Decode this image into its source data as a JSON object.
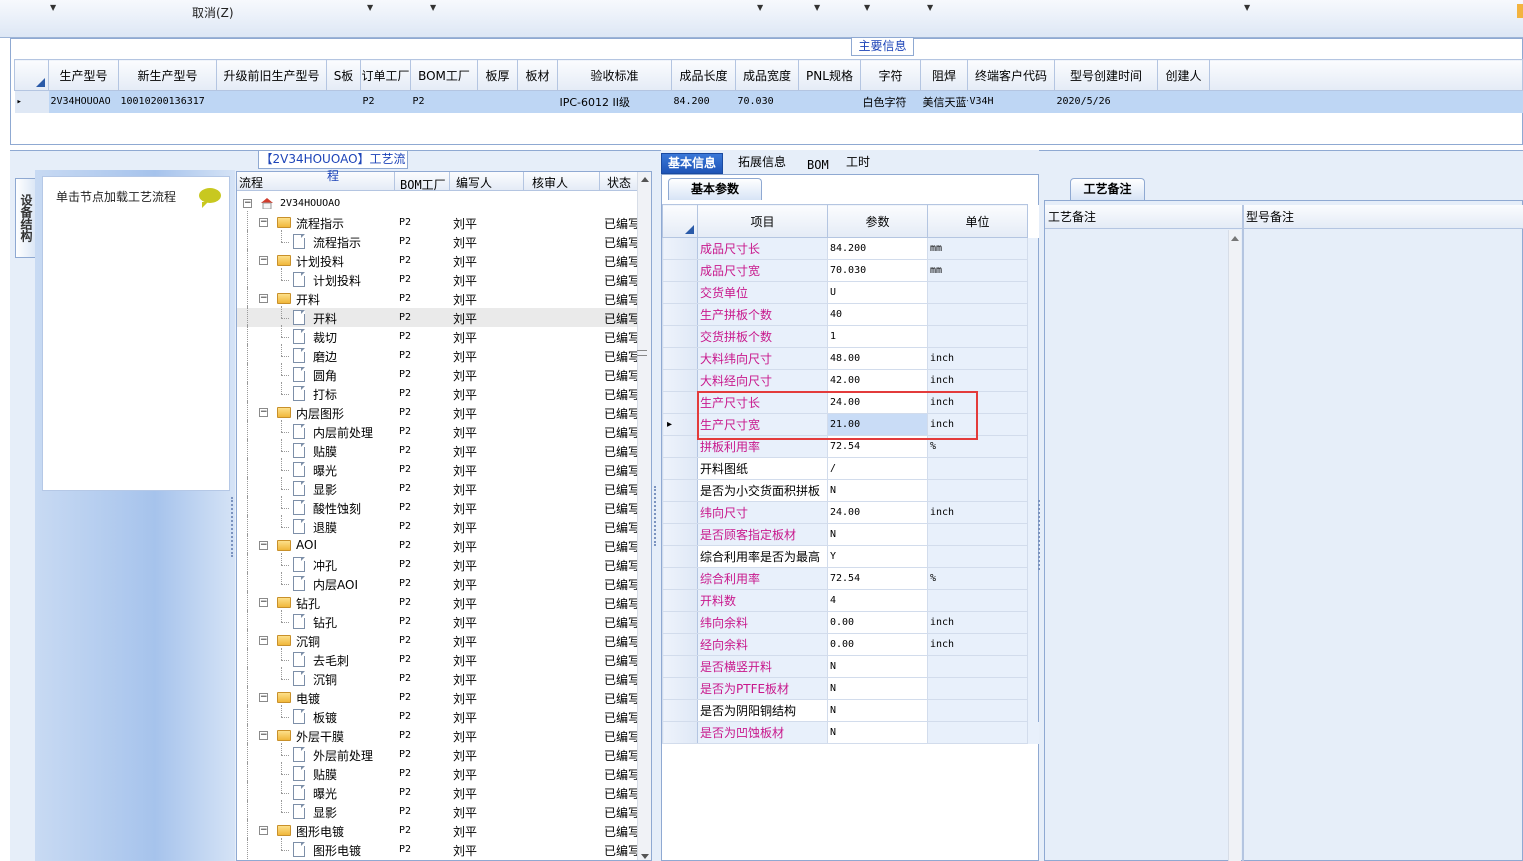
{
  "toolbar": {
    "cancel_label": "取消(Z)"
  },
  "main_info": {
    "title": "主要信息",
    "columns": [
      "生产型号",
      "新生产型号",
      "升级前旧生产型号",
      "S板",
      "订单工厂",
      "BOM工厂",
      "板厚",
      "板材",
      "验收标准",
      "成品长度",
      "成品宽度",
      "PNL规格",
      "字符",
      "阻焊",
      "终端客户代码",
      "型号创建时间",
      "创建人"
    ],
    "row": [
      "2V34HOUOAO",
      "10010200136317",
      "",
      "",
      "P2",
      "P2",
      "",
      "",
      "IPC-6012 II级",
      "84.200",
      "70.030",
      "",
      "白色字符",
      "美信天蓝色",
      "V34H",
      "2020/5/26",
      ""
    ]
  },
  "left_nav": {
    "vertical_tab": "设备结构",
    "hint": "单击节点加载工艺流程"
  },
  "process": {
    "title": "【2V34HOUOAO】工艺流程",
    "columns": [
      "流程",
      "BOM工厂",
      "编写人",
      "核审人",
      "状态"
    ],
    "rows": [
      {
        "name": "2V34HOUOAO",
        "lvl": 0,
        "type": "root",
        "bom": "",
        "writer": "",
        "status": ""
      },
      {
        "name": "流程指示",
        "lvl": 1,
        "type": "folder",
        "bom": "P2",
        "writer": "刘平",
        "status": "已编写"
      },
      {
        "name": "流程指示",
        "lvl": 2,
        "type": "doc",
        "bom": "P2",
        "writer": "刘平",
        "status": "已编写"
      },
      {
        "name": "计划投料",
        "lvl": 1,
        "type": "folder",
        "bom": "P2",
        "writer": "刘平",
        "status": "已编写"
      },
      {
        "name": "计划投料",
        "lvl": 2,
        "type": "doc",
        "bom": "P2",
        "writer": "刘平",
        "status": "已编写"
      },
      {
        "name": "开料",
        "lvl": 1,
        "type": "folder",
        "bom": "P2",
        "writer": "刘平",
        "status": "已编写"
      },
      {
        "name": "开料",
        "lvl": 2,
        "type": "doc",
        "bom": "P2",
        "writer": "刘平",
        "status": "已编写",
        "selected": true
      },
      {
        "name": "裁切",
        "lvl": 2,
        "type": "doc",
        "bom": "P2",
        "writer": "刘平",
        "status": "已编写"
      },
      {
        "name": "磨边",
        "lvl": 2,
        "type": "doc",
        "bom": "P2",
        "writer": "刘平",
        "status": "已编写"
      },
      {
        "name": "圆角",
        "lvl": 2,
        "type": "doc",
        "bom": "P2",
        "writer": "刘平",
        "status": "已编写"
      },
      {
        "name": "打标",
        "lvl": 2,
        "type": "doc",
        "bom": "P2",
        "writer": "刘平",
        "status": "已编写"
      },
      {
        "name": "内层图形",
        "lvl": 1,
        "type": "folder",
        "bom": "P2",
        "writer": "刘平",
        "status": "已编写"
      },
      {
        "name": "内层前处理",
        "lvl": 2,
        "type": "doc",
        "bom": "P2",
        "writer": "刘平",
        "status": "已编写"
      },
      {
        "name": "贴膜",
        "lvl": 2,
        "type": "doc",
        "bom": "P2",
        "writer": "刘平",
        "status": "已编写"
      },
      {
        "name": "曝光",
        "lvl": 2,
        "type": "doc",
        "bom": "P2",
        "writer": "刘平",
        "status": "已编写"
      },
      {
        "name": "显影",
        "lvl": 2,
        "type": "doc",
        "bom": "P2",
        "writer": "刘平",
        "status": "已编写"
      },
      {
        "name": "酸性蚀刻",
        "lvl": 2,
        "type": "doc",
        "bom": "P2",
        "writer": "刘平",
        "status": "已编写"
      },
      {
        "name": "退膜",
        "lvl": 2,
        "type": "doc",
        "bom": "P2",
        "writer": "刘平",
        "status": "已编写"
      },
      {
        "name": "AOI",
        "lvl": 1,
        "type": "folder",
        "bom": "P2",
        "writer": "刘平",
        "status": "已编写"
      },
      {
        "name": "冲孔",
        "lvl": 2,
        "type": "doc",
        "bom": "P2",
        "writer": "刘平",
        "status": "已编写"
      },
      {
        "name": "内层AOI",
        "lvl": 2,
        "type": "doc",
        "bom": "P2",
        "writer": "刘平",
        "status": "已编写"
      },
      {
        "name": "钻孔",
        "lvl": 1,
        "type": "folder",
        "bom": "P2",
        "writer": "刘平",
        "status": "已编写"
      },
      {
        "name": "钻孔",
        "lvl": 2,
        "type": "doc",
        "bom": "P2",
        "writer": "刘平",
        "status": "已编写"
      },
      {
        "name": "沉铜",
        "lvl": 1,
        "type": "folder",
        "bom": "P2",
        "writer": "刘平",
        "status": "已编写"
      },
      {
        "name": "去毛刺",
        "lvl": 2,
        "type": "doc",
        "bom": "P2",
        "writer": "刘平",
        "status": "已编写"
      },
      {
        "name": "沉铜",
        "lvl": 2,
        "type": "doc",
        "bom": "P2",
        "writer": "刘平",
        "status": "已编写"
      },
      {
        "name": "电镀",
        "lvl": 1,
        "type": "folder",
        "bom": "P2",
        "writer": "刘平",
        "status": "已编写"
      },
      {
        "name": "板镀",
        "lvl": 2,
        "type": "doc",
        "bom": "P2",
        "writer": "刘平",
        "status": "已编写"
      },
      {
        "name": "外层干膜",
        "lvl": 1,
        "type": "folder",
        "bom": "P2",
        "writer": "刘平",
        "status": "已编写"
      },
      {
        "name": "外层前处理",
        "lvl": 2,
        "type": "doc",
        "bom": "P2",
        "writer": "刘平",
        "status": "已编写"
      },
      {
        "name": "贴膜",
        "lvl": 2,
        "type": "doc",
        "bom": "P2",
        "writer": "刘平",
        "status": "已编写"
      },
      {
        "name": "曝光",
        "lvl": 2,
        "type": "doc",
        "bom": "P2",
        "writer": "刘平",
        "status": "已编写"
      },
      {
        "name": "显影",
        "lvl": 2,
        "type": "doc",
        "bom": "P2",
        "writer": "刘平",
        "status": "已编写"
      },
      {
        "name": "图形电镀",
        "lvl": 1,
        "type": "folder",
        "bom": "P2",
        "writer": "刘平",
        "status": "已编写"
      },
      {
        "name": "图形电镀",
        "lvl": 2,
        "type": "doc",
        "bom": "P2",
        "writer": "刘平",
        "status": "已编写"
      }
    ]
  },
  "tabs": [
    "基本信息",
    "拓展信息",
    "BOM",
    "工时"
  ],
  "basic": {
    "subtab": "基本参数",
    "columns": [
      "项目",
      "参数",
      "单位"
    ],
    "rows": [
      {
        "item": "成品尺寸长",
        "value": "84.200",
        "unit": "mm",
        "pink": true
      },
      {
        "item": "成品尺寸宽",
        "value": "70.030",
        "unit": "mm",
        "pink": true
      },
      {
        "item": "交货单位",
        "value": "U",
        "unit": "",
        "pink": true
      },
      {
        "item": "生产拼板个数",
        "value": "40",
        "unit": "",
        "pink": true
      },
      {
        "item": "交货拼板个数",
        "value": "1",
        "unit": "",
        "pink": true
      },
      {
        "item": "大料纬向尺寸",
        "value": "48.00",
        "unit": "inch",
        "pink": true
      },
      {
        "item": "大料经向尺寸",
        "value": "42.00",
        "unit": "inch",
        "pink": true
      },
      {
        "item": "生产尺寸长",
        "value": "24.00",
        "unit": "inch",
        "pink": true
      },
      {
        "item": "生产尺寸宽",
        "value": "21.00",
        "unit": "inch",
        "pink": true,
        "current": true
      },
      {
        "item": "拼板利用率",
        "value": "72.54",
        "unit": "%",
        "pink": true
      },
      {
        "item": "开料图纸",
        "value": "/",
        "unit": "",
        "pink": false
      },
      {
        "item": "是否为小交货面积拼板",
        "value": "N",
        "unit": "",
        "pink": false
      },
      {
        "item": "纬向尺寸",
        "value": "24.00",
        "unit": "inch",
        "pink": true
      },
      {
        "item": "是否顾客指定板材",
        "value": "N",
        "unit": "",
        "pink": true
      },
      {
        "item": "综合利用率是否为最高",
        "value": "Y",
        "unit": "",
        "pink": false
      },
      {
        "item": "综合利用率",
        "value": "72.54",
        "unit": "%",
        "pink": true
      },
      {
        "item": "开料数",
        "value": "4",
        "unit": "",
        "pink": true
      },
      {
        "item": "纬向余料",
        "value": "0.00",
        "unit": "inch",
        "pink": true
      },
      {
        "item": "经向余料",
        "value": "0.00",
        "unit": "inch",
        "pink": true
      },
      {
        "item": "是否横竖开料",
        "value": "N",
        "unit": "",
        "pink": true
      },
      {
        "item": "是否为PTFE板材",
        "value": "N",
        "unit": "",
        "pink": true
      },
      {
        "item": "是否为阴阳铜结构",
        "value": "N",
        "unit": "",
        "pink": false
      },
      {
        "item": "是否为凹蚀板材",
        "value": "N",
        "unit": "",
        "pink": true
      }
    ]
  },
  "right_panel": {
    "tab": "工艺备注",
    "col1": "工艺备注",
    "col2": "型号备注"
  }
}
